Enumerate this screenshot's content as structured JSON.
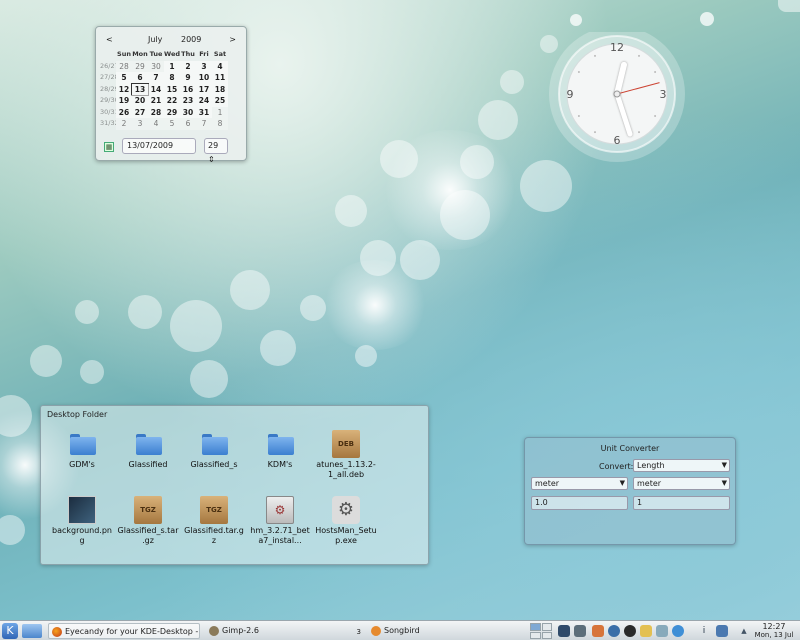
{
  "calendar": {
    "prev": "<",
    "next": ">",
    "month": "July",
    "year": "2009",
    "weekdays": [
      "Sun",
      "Mon",
      "Tue",
      "Wed",
      "Thu",
      "Fri",
      "Sat"
    ],
    "weeks": [
      {
        "wk": "26/27",
        "days": [
          "28",
          "29",
          "30",
          "1",
          "2",
          "3",
          "4"
        ]
      },
      {
        "wk": "27/28",
        "days": [
          "5",
          "6",
          "7",
          "8",
          "9",
          "10",
          "11"
        ]
      },
      {
        "wk": "28/29",
        "days": [
          "12",
          "13",
          "14",
          "15",
          "16",
          "17",
          "18"
        ]
      },
      {
        "wk": "29/30",
        "days": [
          "19",
          "20",
          "21",
          "22",
          "23",
          "24",
          "25"
        ]
      },
      {
        "wk": "30/31",
        "days": [
          "26",
          "27",
          "28",
          "29",
          "30",
          "31",
          "1"
        ]
      },
      {
        "wk": "31/32",
        "days": [
          "2",
          "3",
          "4",
          "5",
          "6",
          "7",
          "8"
        ]
      }
    ],
    "date_value": "13/07/2009",
    "week_value": "29"
  },
  "clock": {
    "numerals": [
      "12",
      "3",
      "6",
      "9"
    ],
    "hour": 12,
    "minute": 27
  },
  "desktop_folder": {
    "title": "Desktop Folder",
    "items": [
      {
        "label": "GDM's",
        "icon": "folder-icon"
      },
      {
        "label": "Glassified",
        "icon": "folder-icon"
      },
      {
        "label": "Glassified_s",
        "icon": "folder-icon"
      },
      {
        "label": "KDM's",
        "icon": "folder-icon"
      },
      {
        "label": "atunes_1.13.2-1_all.deb",
        "icon": "deb-package-icon",
        "badge": "DEB"
      },
      {
        "label": "background.png",
        "icon": "image-file-icon"
      },
      {
        "label": "Glassified_s.tar.gz",
        "icon": "tgz-archive-icon",
        "badge": "TGZ"
      },
      {
        "label": "Glassified.tar.gz",
        "icon": "tgz-archive-icon",
        "badge": "TGZ"
      },
      {
        "label": "hm_3.2.71_beta7_instal...",
        "icon": "installer-icon"
      },
      {
        "label": "HostsMan_Setup.exe",
        "icon": "executable-icon"
      }
    ]
  },
  "converter": {
    "title": "Unit Converter",
    "convert_label": "Convert:",
    "category": "Length",
    "from_unit": "meter",
    "to_unit": "meter",
    "from_value": "1.0",
    "to_value": "1"
  },
  "taskbar": {
    "tasks": [
      {
        "label": "Eyecandy for your KDE-Desktop - M",
        "icon": "firefox-icon"
      },
      {
        "label": "Gimp-2.6",
        "icon": "gimp-icon",
        "count": "3"
      },
      {
        "label": "Songbird",
        "icon": "songbird-icon"
      }
    ],
    "time": "12:27",
    "date": "Mon, 13 Jul"
  }
}
